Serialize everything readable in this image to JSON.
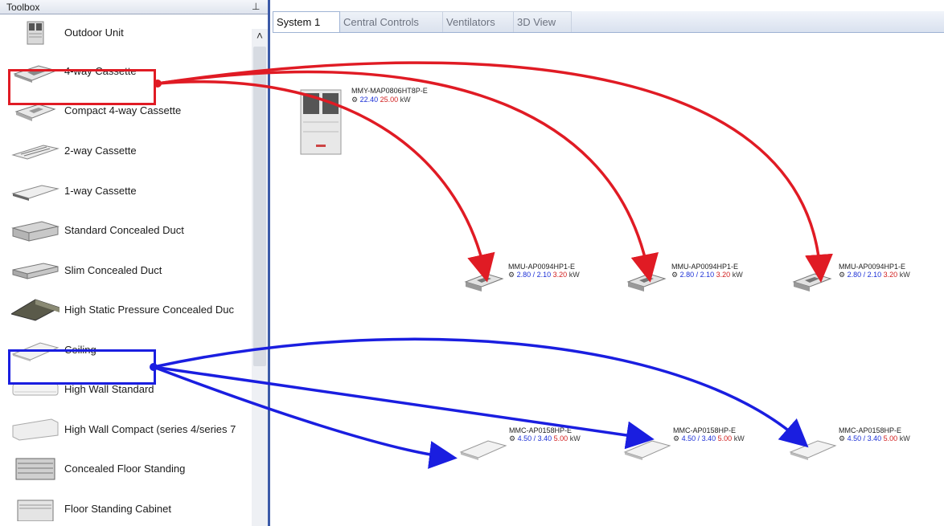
{
  "toolbox": {
    "title": "Toolbox",
    "pin_glyph": "⊥",
    "scroll_up_glyph": "˄",
    "items": [
      {
        "label": "Outdoor Unit",
        "icon": "outdoor-unit-icon"
      },
      {
        "label": "4-way Cassette",
        "icon": "four-way-cassette-icon"
      },
      {
        "label": "Compact 4-way Cassette",
        "icon": "compact-cassette-icon"
      },
      {
        "label": "2-way Cassette",
        "icon": "two-way-cassette-icon"
      },
      {
        "label": "1-way Cassette",
        "icon": "one-way-cassette-icon"
      },
      {
        "label": "Standard Concealed Duct",
        "icon": "standard-duct-icon"
      },
      {
        "label": "Slim Concealed Duct",
        "icon": "slim-duct-icon"
      },
      {
        "label": "High Static Pressure Concealed Duc",
        "icon": "high-static-duct-icon"
      },
      {
        "label": "Ceiling",
        "icon": "ceiling-unit-icon"
      },
      {
        "label": "High Wall Standard",
        "icon": "high-wall-icon"
      },
      {
        "label": "High Wall Compact (series 4/series 7",
        "icon": "high-wall-compact-icon"
      },
      {
        "label": "Concealed Floor Standing",
        "icon": "floor-concealed-icon"
      },
      {
        "label": "Floor Standing Cabinet",
        "icon": "floor-cabinet-icon"
      }
    ]
  },
  "tabs": [
    {
      "label": "System 1",
      "active": true
    },
    {
      "label": "Central Controls",
      "active": false
    },
    {
      "label": "Ventilators",
      "active": false
    },
    {
      "label": "3D View",
      "active": false
    }
  ],
  "canvas": {
    "outdoor_unit": {
      "model": "MMY-MAP0806HT8P-E",
      "values": [
        "22.40",
        "25.00",
        "kW"
      ]
    },
    "cassettes": [
      {
        "model": "MMU-AP0094HP1-E",
        "values": [
          "2.80 /",
          "2.10",
          "3.20",
          "kW"
        ]
      },
      {
        "model": "MMU-AP0094HP1-E",
        "values": [
          "2.80 /",
          "2.10",
          "3.20",
          "kW"
        ]
      },
      {
        "model": "MMU-AP0094HP1-E",
        "values": [
          "2.80 /",
          "2.10",
          "3.20",
          "kW"
        ]
      }
    ],
    "ceilings": [
      {
        "model": "MMC-AP0158HP-E",
        "values": [
          "4.50 /",
          "3.40",
          "5.00",
          "kW"
        ]
      },
      {
        "model": "MMC-AP0158HP-E",
        "values": [
          "4.50 /",
          "3.40",
          "5.00",
          "kW"
        ]
      },
      {
        "model": "MMC-AP0158HP-E",
        "values": [
          "4.50 /",
          "3.40",
          "5.00",
          "kW"
        ]
      }
    ]
  },
  "colors": {
    "cassette_arrows": "#e01b24",
    "ceiling_arrows": "#1a1ee0",
    "panel_border": "#3c5aa8"
  }
}
